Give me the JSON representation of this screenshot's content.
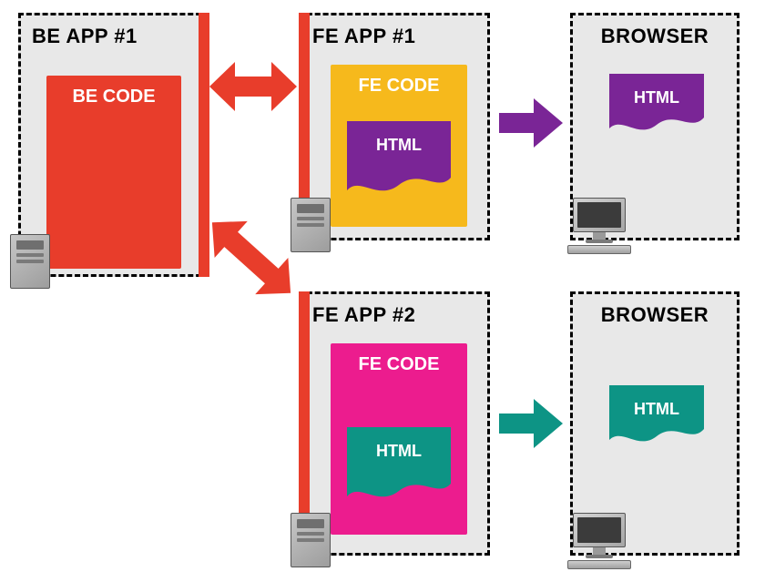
{
  "colors": {
    "red": "#e83d2b",
    "orange": "#f6b91c",
    "purple": "#7a2596",
    "magenta": "#ec1c8e",
    "teal": "#0d9485"
  },
  "be_app": {
    "title": "BE APP #1",
    "code_label": "BE CODE"
  },
  "fe_app_1": {
    "title": "FE APP #1",
    "code_label": "FE CODE",
    "html_label": "HTML"
  },
  "fe_app_2": {
    "title": "FE APP #2",
    "code_label": "FE CODE",
    "html_label": "HTML"
  },
  "browser_1": {
    "title": "BROWSER",
    "html_label": "HTML"
  },
  "browser_2": {
    "title": "BROWSER",
    "html_label": "HTML"
  }
}
